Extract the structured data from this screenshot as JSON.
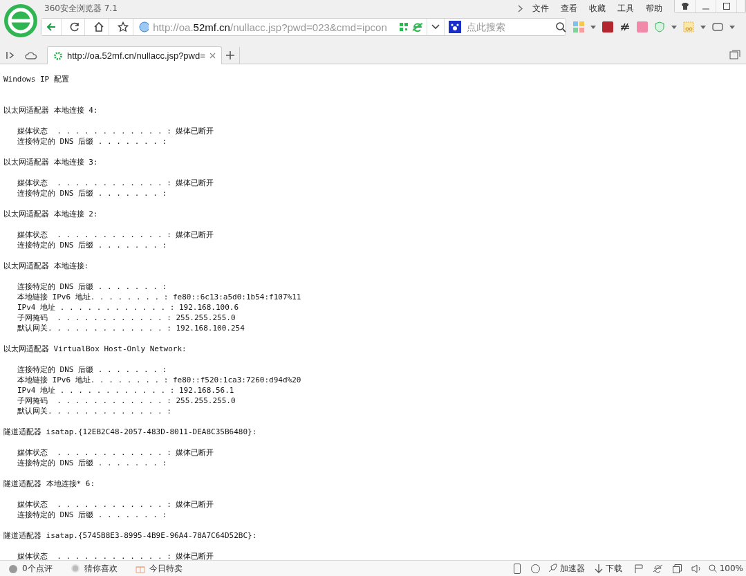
{
  "window": {
    "title": "360安全浏览器 7.1"
  },
  "menu": [
    "文件",
    "查看",
    "收藏",
    "工具",
    "帮助"
  ],
  "address": {
    "prefix": "http://oa.",
    "domain": "52mf.cn",
    "rest": "/nullacc.jsp?pwd=023&cmd=ipcon"
  },
  "search": {
    "placeholder": "点此搜索"
  },
  "tabs": [
    {
      "label": "http://oa.52mf.cn/nullacc.jsp?pwd=",
      "selected": true
    }
  ],
  "page": {
    "title": "Windows IP 配置",
    "sections": [
      {
        "heading": "以太网适配器 本地连接 4:",
        "entries": [
          "媒体状态  . . . . . . . . . . . . : 媒体已断开",
          "连接特定的 DNS 后缀 . . . . . . . :"
        ]
      },
      {
        "heading": "以太网适配器 本地连接 3:",
        "entries": [
          "媒体状态  . . . . . . . . . . . . : 媒体已断开",
          "连接特定的 DNS 后缀 . . . . . . . :"
        ]
      },
      {
        "heading": "以太网适配器 本地连接 2:",
        "entries": [
          "媒体状态  . . . . . . . . . . . . : 媒体已断开",
          "连接特定的 DNS 后缀 . . . . . . . :"
        ]
      },
      {
        "heading": "以太网适配器 本地连接:",
        "entries": [
          "连接特定的 DNS 后缀 . . . . . . . :",
          "本地链接 IPv6 地址. . . . . . . . : fe80::6c13:a5d0:1b54:f107%11",
          "IPv4 地址 . . . . . . . . . . . . : 192.168.100.6",
          "子网掩码  . . . . . . . . . . . . : 255.255.255.0",
          "默认网关. . . . . . . . . . . . . : 192.168.100.254"
        ]
      },
      {
        "heading": "以太网适配器 VirtualBox Host-Only Network:",
        "entries": [
          "连接特定的 DNS 后缀 . . . . . . . :",
          "本地链接 IPv6 地址. . . . . . . . : fe80::f520:1ca3:7260:d94d%20",
          "IPv4 地址 . . . . . . . . . . . . : 192.168.56.1",
          "子网掩码  . . . . . . . . . . . . : 255.255.255.0",
          "默认网关. . . . . . . . . . . . . :"
        ]
      },
      {
        "heading": "隧道适配器 isatap.{12EB2C48-2057-483D-8011-DEA8C35B6480}:",
        "entries": [
          "媒体状态  . . . . . . . . . . . . : 媒体已断开",
          "连接特定的 DNS 后缀 . . . . . . . :"
        ]
      },
      {
        "heading": "隧道适配器 本地连接* 6:",
        "entries": [
          "媒体状态  . . . . . . . . . . . . : 媒体已断开",
          "连接特定的 DNS 后缀 . . . . . . . :"
        ]
      },
      {
        "heading": "隧道适配器 isatap.{5745B8E3-8995-4B9E-96A4-78A7C64D52BC}:",
        "entries": [
          "媒体状态  . . . . . . . . . . . . : 媒体已断开"
        ]
      }
    ]
  },
  "status_left": [
    "0个点评",
    "猜你喜欢",
    "今日特卖"
  ],
  "status_right": {
    "accelerator": "加速器",
    "download": "下载",
    "zoom": "100%"
  }
}
